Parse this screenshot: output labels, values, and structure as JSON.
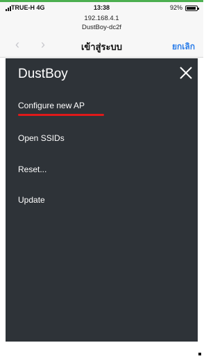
{
  "status_bar": {
    "carrier": "TRUE-H  4G",
    "time": "13:38",
    "battery": "92%"
  },
  "browser": {
    "url_line1": "192.168.4.1",
    "url_line2": "DustBoy-dc2f",
    "title": "เข้าสู่ระบบ",
    "cancel_label": "ยกเลิก",
    "back_icon": "‹",
    "forward_icon": "›"
  },
  "app": {
    "title": "DustBoy",
    "close_icon": "close-icon",
    "menu": [
      {
        "label": "Configure new AP"
      },
      {
        "label": "Open SSIDs"
      },
      {
        "label": "Reset..."
      },
      {
        "label": "Update"
      }
    ],
    "highlight_color": "#e01919",
    "panel_color": "#2e3338",
    "accent_color": "#2b7de9"
  }
}
